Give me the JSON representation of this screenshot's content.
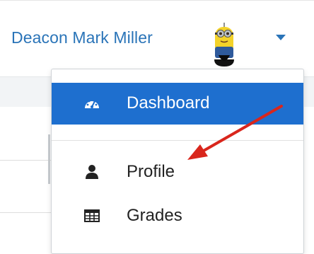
{
  "user_menu": {
    "name": "Deacon Mark Miller",
    "avatar_icon": "minion-avatar",
    "caret_icon": "caret-down-icon"
  },
  "dropdown": {
    "items": [
      {
        "label": "Dashboard",
        "icon": "tachometer-icon",
        "active": true
      },
      {
        "label": "Profile",
        "icon": "user-icon",
        "active": false
      },
      {
        "label": "Grades",
        "icon": "table-icon",
        "active": false
      }
    ]
  },
  "annotation": {
    "type": "red-arrow",
    "points_to": "Profile",
    "color": "#d9261c"
  },
  "colors": {
    "accent": "#1e6fcf",
    "link": "#2a74b8",
    "arrow": "#d9261c"
  }
}
